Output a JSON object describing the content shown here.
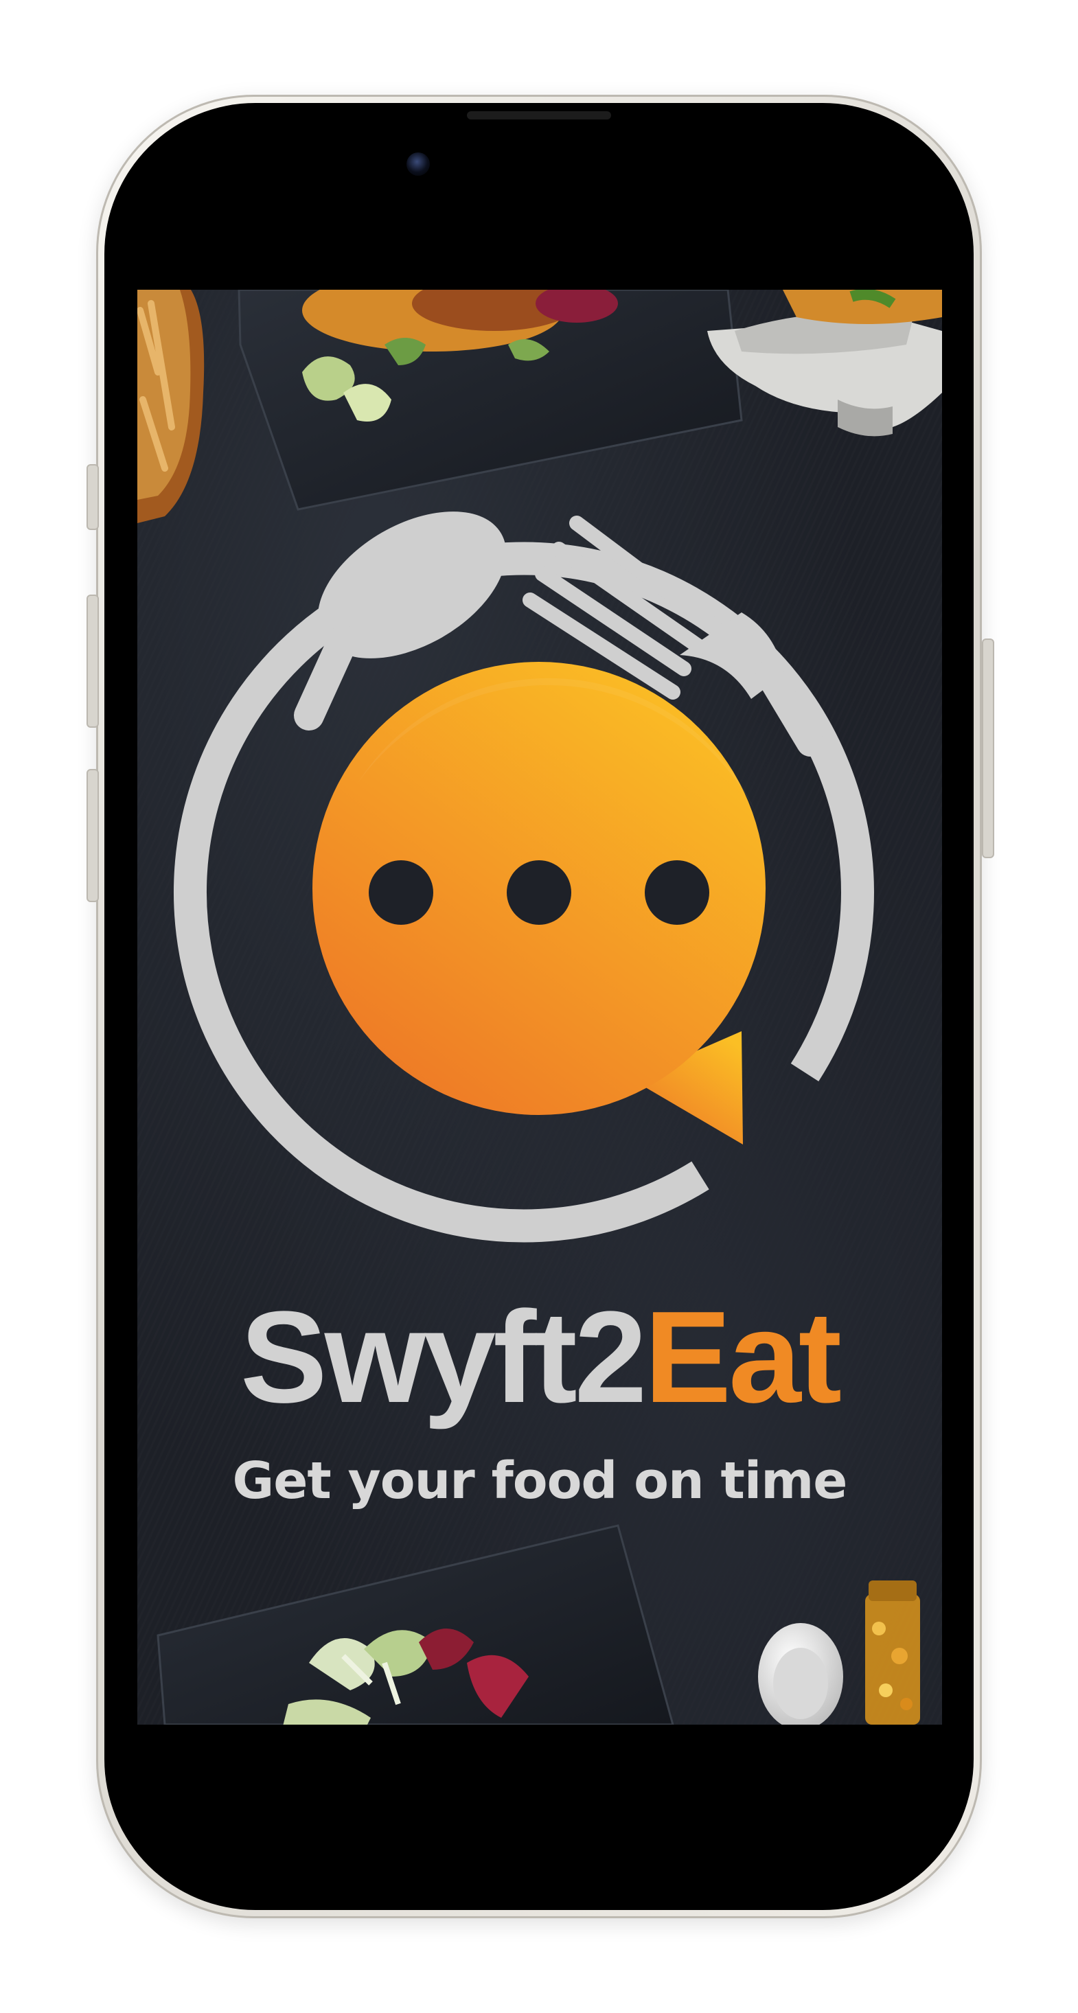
{
  "brand": {
    "name_part1": "Swyft2",
    "name_part2": "Eat",
    "tagline": "Get your food on time",
    "color_part1": "#d2d2d2",
    "color_part2": "#f08a24"
  },
  "logo": {
    "icon_names": [
      "spoon-icon",
      "fork-icon",
      "plate-ring-icon",
      "chat-bubble-icon",
      "typing-dots-icon"
    ],
    "colors": {
      "ring": "#cfcfcf",
      "bubble_start": "#fbbf25",
      "bubble_end": "#ee7a26",
      "dots": "#1e2128"
    }
  },
  "background": {
    "colors": {
      "slate": "#1d2027"
    }
  },
  "device": {
    "frame_color": "#eeebe4",
    "bezel_color": "#000000"
  }
}
